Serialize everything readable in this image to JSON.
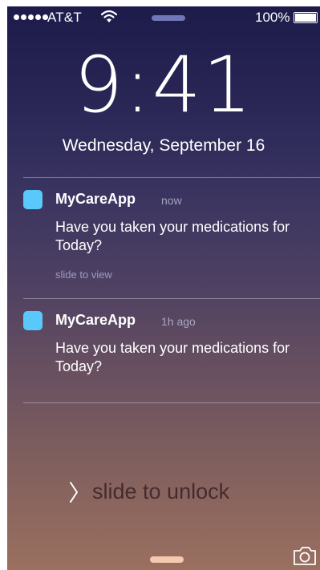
{
  "status_bar": {
    "carrier": "AT&T",
    "battery_percent": "100%",
    "signal_icon": "signal-dots-icon",
    "wifi_icon": "wifi-icon",
    "battery_icon": "battery-icon",
    "battery_level": 1.0
  },
  "lock_screen": {
    "time": "9:41",
    "date": "Wednesday, September 16",
    "unlock_label": "slide to unlock",
    "unlock_icon": "chevron-right-icon",
    "camera_icon": "camera-icon"
  },
  "notifications": [
    {
      "app_name": "MyCareApp",
      "time": "now",
      "message": "Have you taken your medications for Today?",
      "action_hint": "slide to view",
      "icon_color": "#5ac8fa"
    },
    {
      "app_name": "MyCareApp",
      "time": "1h ago",
      "message": "Have you taken your medications for Today?",
      "icon_color": "#5ac8fa"
    }
  ],
  "colors": {
    "app_icon": "#5ac8fa",
    "home_indicator": "#f7c8b0"
  }
}
